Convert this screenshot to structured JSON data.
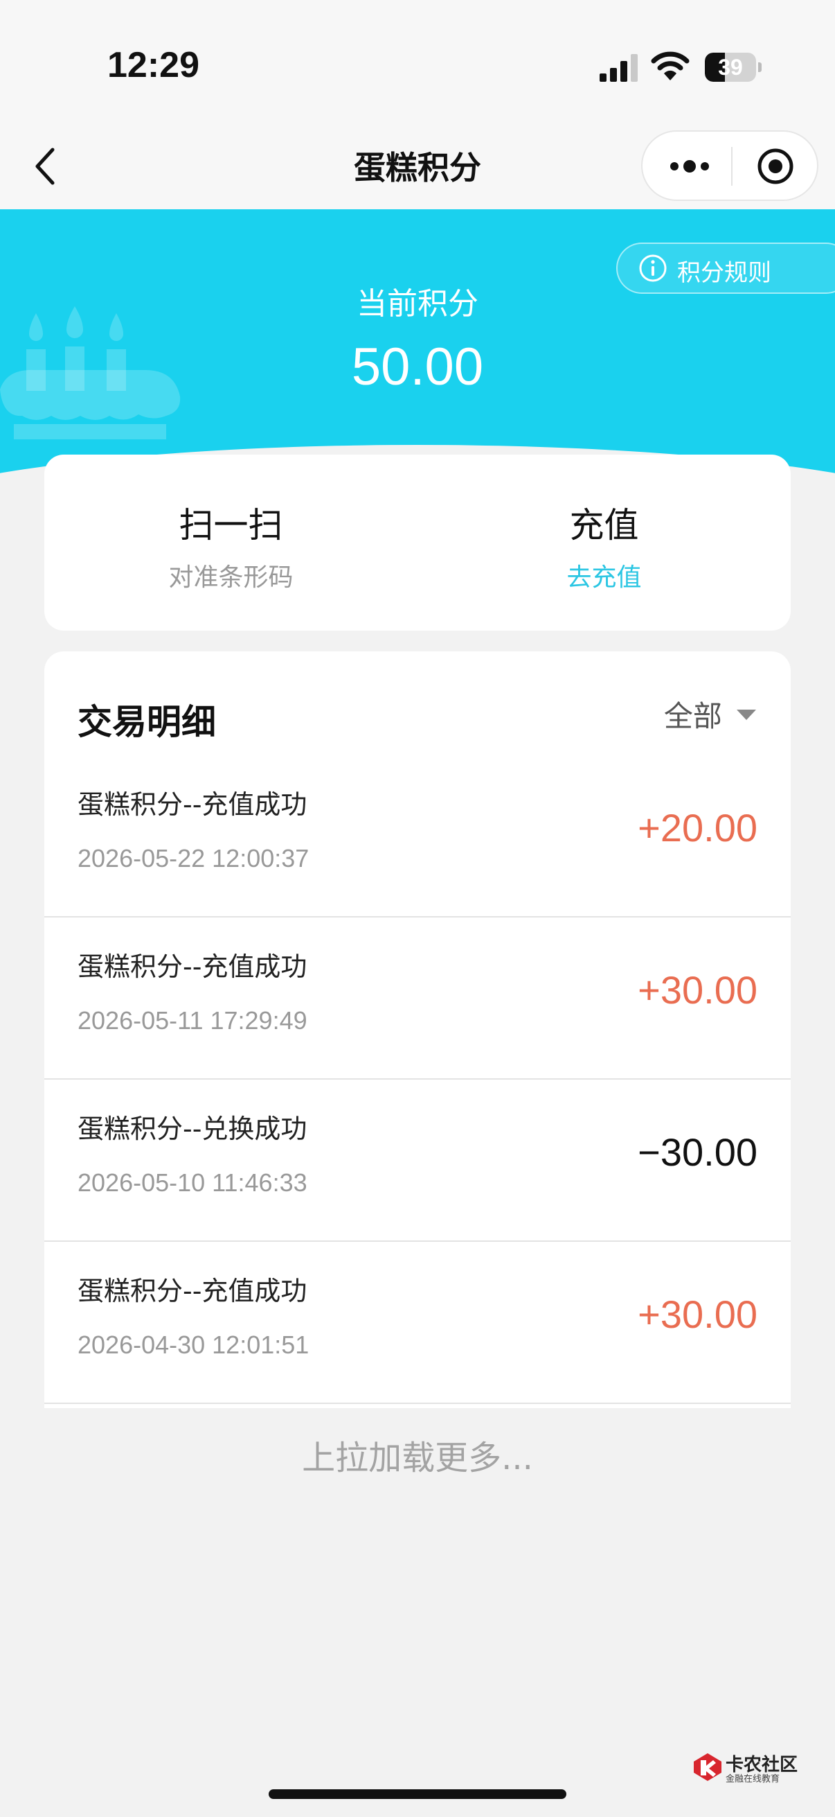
{
  "status_bar": {
    "time": "12:29",
    "battery": "39",
    "battery_level": 0.39
  },
  "nav": {
    "title": "蛋糕积分"
  },
  "banner": {
    "rules_label": "积分规则",
    "points_label": "当前积分",
    "points_value": "50.00",
    "color": "#1ad1ee"
  },
  "actions": {
    "scan_title": "扫一扫",
    "scan_sub": "对准条形码",
    "recharge_title": "充值",
    "recharge_sub": "去充值"
  },
  "transactions": {
    "title": "交易明细",
    "filter_label": "全部",
    "rows": [
      {
        "name": "蛋糕积分--充值成功",
        "time": "2026-05-22 12:00:37",
        "amount": "+20.00",
        "sign": "positive"
      },
      {
        "name": "蛋糕积分--充值成功",
        "time": "2026-05-11 17:29:49",
        "amount": "+30.00",
        "sign": "positive"
      },
      {
        "name": "蛋糕积分--兑换成功",
        "time": "2026-05-10 11:46:33",
        "amount": "−30.00",
        "sign": "negative"
      },
      {
        "name": "蛋糕积分--充值成功",
        "time": "2026-04-30 12:01:51",
        "amount": "+30.00",
        "sign": "positive"
      }
    ],
    "load_more": "上拉加载更多..."
  },
  "watermark": {
    "title": "卡农社区",
    "subtitle": "金融在线教育"
  },
  "colors": {
    "accent": "#1ad1ee",
    "link": "#2bc6e3",
    "positive_amount": "#e96d51",
    "negative_amount": "#111111"
  }
}
